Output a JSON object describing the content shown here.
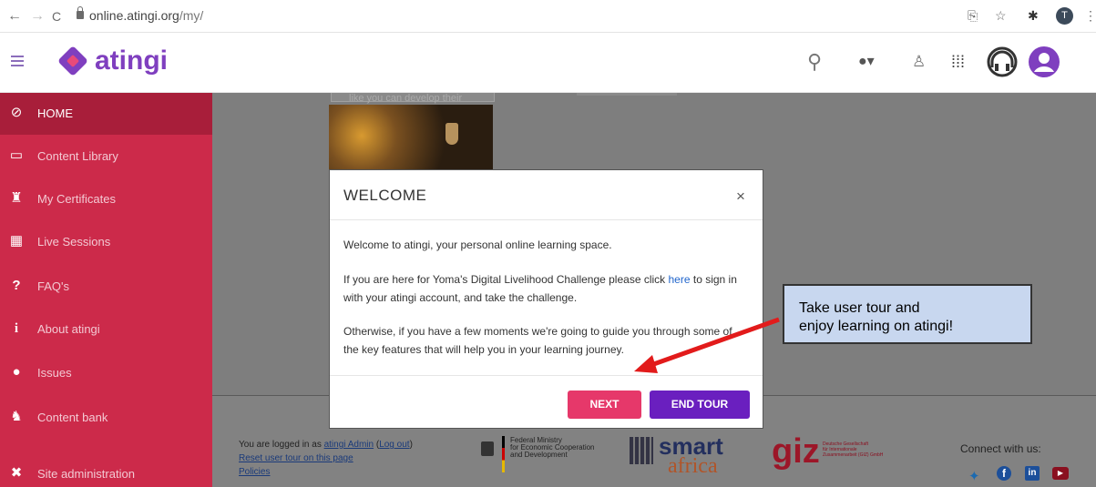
{
  "browser": {
    "back": "←",
    "forward": "→",
    "reload": "C",
    "url_host": "online.atingi.org",
    "url_path": "/my/",
    "profile_initial": "T"
  },
  "header": {
    "brand": "atingi"
  },
  "sidebar": {
    "items": [
      {
        "label": "HOME",
        "icon": "compass-icon",
        "glyph": "⊘"
      },
      {
        "label": "Content Library",
        "icon": "folder-icon",
        "glyph": "▭"
      },
      {
        "label": "My Certificates",
        "icon": "trophy-icon",
        "glyph": "♜"
      },
      {
        "label": "Live Sessions",
        "icon": "calendar-icon",
        "glyph": "▦"
      },
      {
        "label": "FAQ's",
        "icon": "question-icon",
        "glyph": "?"
      },
      {
        "label": "About atingi",
        "icon": "info-icon",
        "glyph": "i"
      },
      {
        "label": "Issues",
        "icon": "info-circle-icon",
        "glyph": "●"
      },
      {
        "label": "Content bank",
        "icon": "content-bank-icon",
        "glyph": "♞"
      },
      {
        "label": "Site administration",
        "icon": "wrench-icon",
        "glyph": "✖"
      }
    ]
  },
  "main": {
    "card_text": "like you can develop their"
  },
  "footer": {
    "logged_in_prefix": "You are logged in as ",
    "user_link": "atingi Admin",
    "logout_link": "Log out",
    "reset_tour": "Reset user tour on this page",
    "policies": "Policies",
    "ministry": "Federal Ministry\nfor Economic Cooperation\nand Development",
    "smart": "smart",
    "africa": "africa",
    "giz": "giz",
    "giz_sub": "Deutsche Gesellschaft\nfür Internationale\nZusammenarbeit (GIZ) GmbH",
    "connect": "Connect with us:"
  },
  "modal": {
    "title": "WELCOME",
    "close": "×",
    "p1": "Welcome to atingi, your personal online learning space.",
    "p2_before": "If you are here for Yoma's Digital Livelihood Challenge please click ",
    "p2_link": "here",
    "p2_after": " to sign in with your atingi account, and take the challenge.",
    "p3": "Otherwise, if you have a few moments we're going to guide you through some of the key features that will help you in your learning journey.",
    "next": "NEXT",
    "end_tour": "END TOUR"
  },
  "callout": {
    "line1": "Take user tour and",
    "line2": "enjoy learning on atingi!"
  },
  "colors": {
    "sidebar": "#cc2a4a",
    "brand": "#7f3fbf",
    "next": "#e6386a",
    "end": "#6a1fbf"
  }
}
